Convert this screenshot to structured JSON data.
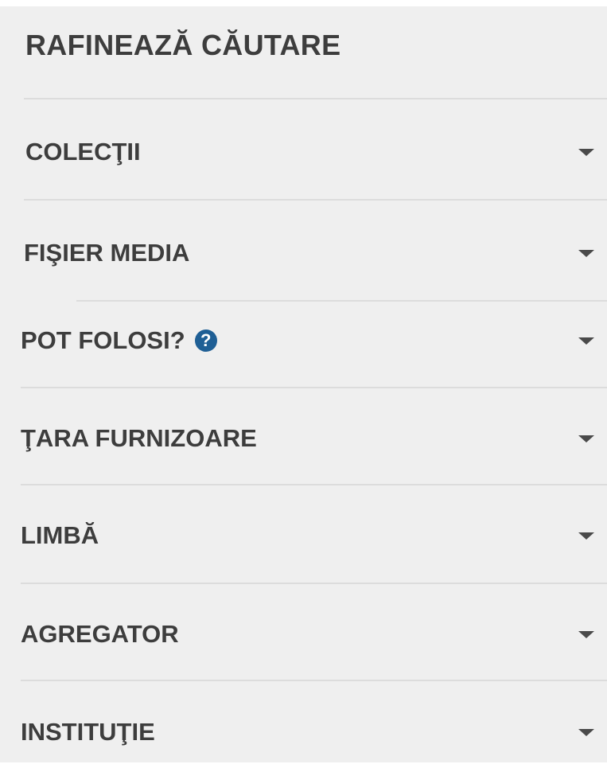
{
  "heading": "RAFINEAZĂ CĂUTARE",
  "facets": [
    {
      "label": "COLECŢII"
    },
    {
      "label": "FIŞIER MEDIA"
    },
    {
      "label": "POT FOLOSI?",
      "help": "?"
    },
    {
      "label": "ŢARA FURNIZOARE"
    },
    {
      "label": "LIMBĂ"
    },
    {
      "label": "AGREGATOR"
    },
    {
      "label": "INSTITUŢIE"
    }
  ],
  "colors": {
    "panel_background": "#efefef",
    "text": "#3d3d3d",
    "divider": "#dcdcdc",
    "help_icon": "#1f5f95",
    "caret": "#4a4a4a"
  },
  "icons": {
    "help": "question-circle-icon",
    "expand": "caret-down-icon"
  }
}
